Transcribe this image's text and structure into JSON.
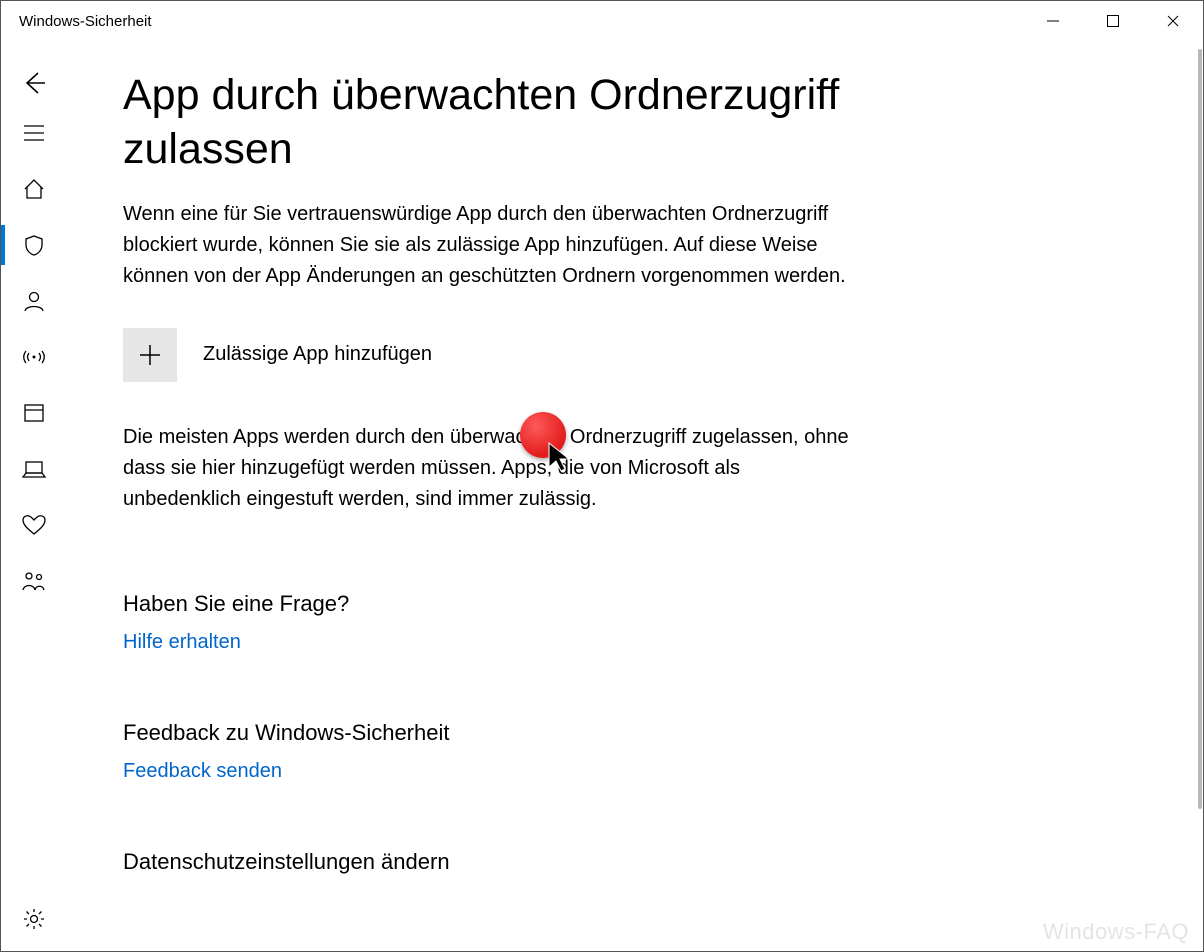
{
  "window": {
    "title": "Windows-Sicherheit"
  },
  "page": {
    "title": "App durch überwachten Ordnerzugriff zulassen",
    "intro": "Wenn eine für Sie vertrauenswürdige App durch den überwachten Ordnerzugriff blockiert wurde, können Sie sie als zulässige App hinzufügen. Auf diese Weise können von der App Änderungen an geschützten Ordnern vorgenommen werden.",
    "add_app_label": "Zulässige App hinzufügen",
    "info2": "Die meisten Apps werden durch den überwachten Ordnerzugriff zugelassen, ohne dass sie hier hinzugefügt werden müssen. Apps, die von Microsoft als unbedenklich eingestuft werden, sind immer zulässig.",
    "help_heading": "Haben Sie eine Frage?",
    "help_link": "Hilfe erhalten",
    "feedback_heading": "Feedback zu Windows-Sicherheit",
    "feedback_link": "Feedback senden",
    "privacy_heading": "Datenschutzeinstellungen ändern"
  },
  "sidebar": {
    "items": [
      {
        "name": "back"
      },
      {
        "name": "menu"
      },
      {
        "name": "home"
      },
      {
        "name": "shield",
        "active": true
      },
      {
        "name": "account"
      },
      {
        "name": "firewall"
      },
      {
        "name": "app-browser"
      },
      {
        "name": "device-security"
      },
      {
        "name": "device-performance"
      },
      {
        "name": "family"
      }
    ],
    "settings": {
      "name": "settings"
    }
  },
  "watermark": "Windows-FAQ"
}
